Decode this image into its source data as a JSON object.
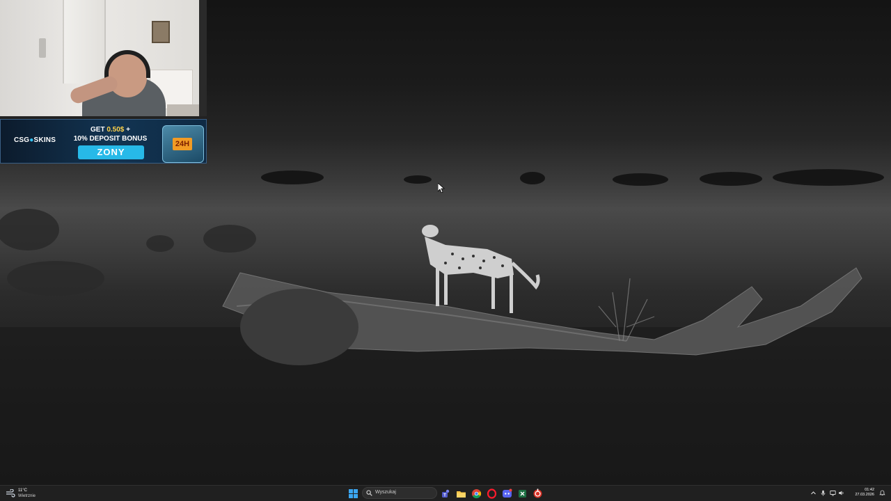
{
  "webcam": {
    "description_label": "streamer webcam"
  },
  "banner": {
    "logo_prefix": "CSG",
    "logo_suffix": "SKINS",
    "promo_line1_prefix": "GET ",
    "promo_line1_amount": "0.50$",
    "promo_line1_suffix": " +",
    "promo_line2": "10% DEPOSIT BONUS",
    "promo_code": "ZONY",
    "crate_badge": "24H"
  },
  "taskbar": {
    "weather": {
      "temperature": "11°C",
      "condition": "Wietrznie",
      "icon": "weather-wind-icon"
    },
    "search": {
      "placeholder": "Wyszukaj"
    },
    "pinned": [
      {
        "name": "start-button",
        "icon": "windows-logo-icon"
      },
      {
        "name": "teams",
        "icon": "teams-icon"
      },
      {
        "name": "file-explorer",
        "icon": "folder-icon"
      },
      {
        "name": "chrome",
        "icon": "chrome-icon"
      },
      {
        "name": "opera",
        "icon": "opera-icon"
      },
      {
        "name": "discord",
        "icon": "discord-icon"
      },
      {
        "name": "excel",
        "icon": "excel-icon"
      },
      {
        "name": "cs-app",
        "icon": "red-app-icon"
      }
    ],
    "clock": {
      "time": "01:42",
      "date": "27.03.2026"
    }
  },
  "colors": {
    "taskbar_bg": "#202020",
    "banner_accent": "#27b9e8",
    "banner_highlight": "#ffd24a"
  }
}
